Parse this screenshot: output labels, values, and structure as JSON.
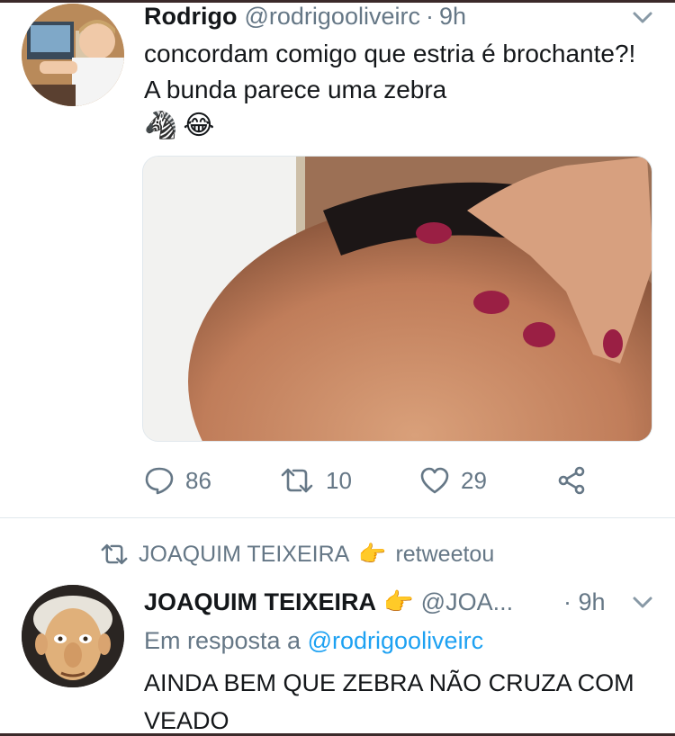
{
  "tweet1": {
    "name": "Rodrigo",
    "handle": "@rodrigooliveirc",
    "dot": "·",
    "time": "9h",
    "text": "concordam comigo que estria é brochante?! A bunda parece uma zebra",
    "emojis": [
      "🦓",
      "😂"
    ],
    "actions": {
      "replies": "86",
      "retweets": "10",
      "likes": "29"
    }
  },
  "retweet_banner": {
    "name": "JOAQUIM TEIXEIRA",
    "emoji": "👉",
    "label": "retweetou"
  },
  "tweet2": {
    "name": "JOAQUIM TEIXEIRA",
    "emoji": "👉",
    "handle": "@JOA...",
    "time": "· 9h",
    "reply_prefix": "Em resposta a",
    "reply_handle": "@rodrigooliveirc",
    "text": "AINDA BEM QUE ZEBRA NÃO CRUZA COM VEADO"
  },
  "colors": {
    "text": "#14171a",
    "secondary": "#657786",
    "link": "#1da1f2",
    "border": "#e1e8ed"
  },
  "icons": [
    "chevron-down-icon",
    "reply-icon",
    "retweet-icon",
    "like-icon",
    "share-icon"
  ]
}
